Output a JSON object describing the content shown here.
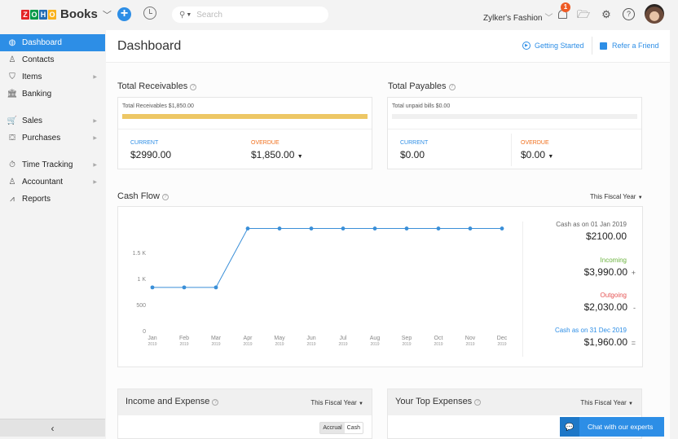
{
  "topbar": {
    "logo_letters": [
      "Z",
      "O",
      "H",
      "O"
    ],
    "logo_colors": [
      "#e42527",
      "#089949",
      "#226db4",
      "#f9b21d"
    ],
    "product": "Books",
    "search_placeholder": "Search",
    "org_name": "Zylker's Fashion",
    "notification_count": "1",
    "icons": [
      "add-icon",
      "history-icon",
      "search-icon",
      "bell-icon",
      "folder-icon",
      "gear-icon",
      "help-icon",
      "avatar"
    ]
  },
  "sidebar": {
    "items": [
      {
        "label": "Dashboard",
        "icon": "dashboard-icon",
        "active": true,
        "has_submenu": false
      },
      {
        "label": "Contacts",
        "icon": "contacts-icon",
        "active": false,
        "has_submenu": false
      },
      {
        "label": "Items",
        "icon": "items-icon",
        "active": false,
        "has_submenu": true
      },
      {
        "label": "Banking",
        "icon": "bank-icon",
        "active": false,
        "has_submenu": false
      },
      {
        "label": "Sales",
        "icon": "cart-icon",
        "active": false,
        "has_submenu": true
      },
      {
        "label": "Purchases",
        "icon": "bag-icon",
        "active": false,
        "has_submenu": true
      },
      {
        "label": "Time Tracking",
        "icon": "stopwatch-icon",
        "active": false,
        "has_submenu": true
      },
      {
        "label": "Accountant",
        "icon": "accountant-icon",
        "active": false,
        "has_submenu": true
      },
      {
        "label": "Reports",
        "icon": "reports-icon",
        "active": false,
        "has_submenu": false
      }
    ],
    "collapse_label": "‹"
  },
  "header": {
    "title": "Dashboard",
    "getting_started": "Getting Started",
    "refer_friend": "Refer a Friend"
  },
  "receivables": {
    "title": "Total Receivables",
    "bar_label": "Total Receivables $1,850.00",
    "bar_fill_fraction": 1.0,
    "current_label": "CURRENT",
    "current_value": "$2990.00",
    "overdue_label": "OVERDUE",
    "overdue_value": "$1,850.00"
  },
  "payables": {
    "title": "Total Payables",
    "bar_label": "Total unpaid bills $0.00",
    "bar_fill_fraction": 0.0,
    "current_label": "CURRENT",
    "current_value": "$0.00",
    "overdue_label": "OVERDUE",
    "overdue_value": "$0.00"
  },
  "cashflow": {
    "title": "Cash Flow",
    "period": "This Fiscal Year",
    "summary": {
      "opening_label": "Cash as on 01 Jan 2019",
      "opening_value": "$2100.00",
      "incoming_label": "Incoming",
      "incoming_value": "$3,990.00",
      "incoming_op": "+",
      "outgoing_label": "Outgoing",
      "outgoing_value": "$2,030.00",
      "outgoing_op": "-",
      "closing_label": "Cash as on 31 Dec 2019",
      "closing_value": "$1,960.00",
      "closing_op": "="
    }
  },
  "chart_data": {
    "type": "line",
    "title": "Cash Flow",
    "categories": [
      "Jan",
      "Feb",
      "Mar",
      "Apr",
      "May",
      "Jun",
      "Jul",
      "Aug",
      "Sep",
      "Oct",
      "Nov",
      "Dec"
    ],
    "category_sublabel": "2019",
    "series": [
      {
        "name": "Cash",
        "color": "#3a8fd8",
        "values": [
          830,
          830,
          830,
          1960,
          1960,
          1960,
          1960,
          1960,
          1960,
          1960,
          1960,
          1960
        ]
      }
    ],
    "yticks": [
      0,
      500,
      1000,
      1500
    ],
    "ytick_labels": [
      "0",
      "500",
      "1 K",
      "1.5 K"
    ],
    "ylim": [
      0,
      2000
    ],
    "xlabel": "",
    "ylabel": "",
    "grid": false,
    "legend": "none"
  },
  "income_expense": {
    "title": "Income and Expense",
    "period": "This Fiscal Year",
    "toggle": [
      "Accrual",
      "Cash"
    ],
    "toggle_active": "Accrual"
  },
  "top_expenses": {
    "title": "Your Top Expenses",
    "period": "This Fiscal Year"
  },
  "chat": {
    "label": "Chat with our experts"
  },
  "colors": {
    "accent": "#2d8ee6",
    "receivable_bar": "#edc765",
    "overdue": "#f06e1a",
    "incoming": "#6cb33f",
    "outgoing": "#e55353",
    "closing": "#2d8ee6"
  }
}
